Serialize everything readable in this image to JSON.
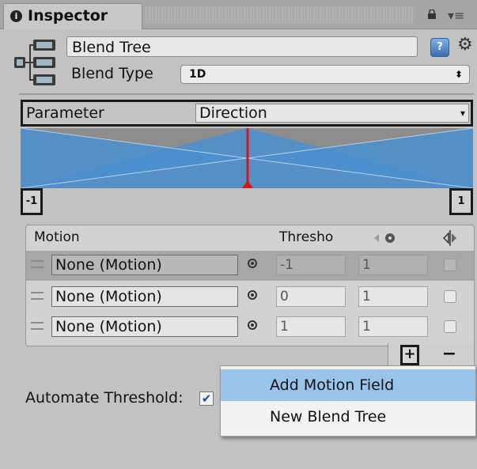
{
  "tab": {
    "icon": "info-icon",
    "label": "Inspector"
  },
  "header": {
    "name": "Blend Tree",
    "blend_type_label": "Blend Type",
    "blend_type_value": "1D"
  },
  "parameter": {
    "label": "Parameter",
    "value": "Direction"
  },
  "graph": {
    "min_label": "-1",
    "max_label": "1",
    "colors": {
      "blue": "#4a8fcf",
      "gray": "#8d8d8d",
      "marker": "#d01818"
    }
  },
  "motion_list": {
    "headers": {
      "motion": "Motion",
      "threshold": "Thresho"
    },
    "header_icons": [
      "time-scale-icon",
      "mirror-icon"
    ],
    "rows": [
      {
        "motion": "None (Motion)",
        "threshold": "-1",
        "speed": "1",
        "mirror": false,
        "selected": true
      },
      {
        "motion": "None (Motion)",
        "threshold": "0",
        "speed": "1",
        "mirror": false,
        "selected": false
      },
      {
        "motion": "None (Motion)",
        "threshold": "1",
        "speed": "1",
        "mirror": false,
        "selected": false
      }
    ],
    "add_symbol": "+",
    "remove_symbol": "−"
  },
  "automate_threshold": {
    "label": "Automate Threshold:",
    "checked": true,
    "check_glyph": "✔"
  },
  "context_menu": {
    "items": [
      "Add Motion Field",
      "New Blend Tree"
    ],
    "highlight_color": "#99c4ea"
  }
}
